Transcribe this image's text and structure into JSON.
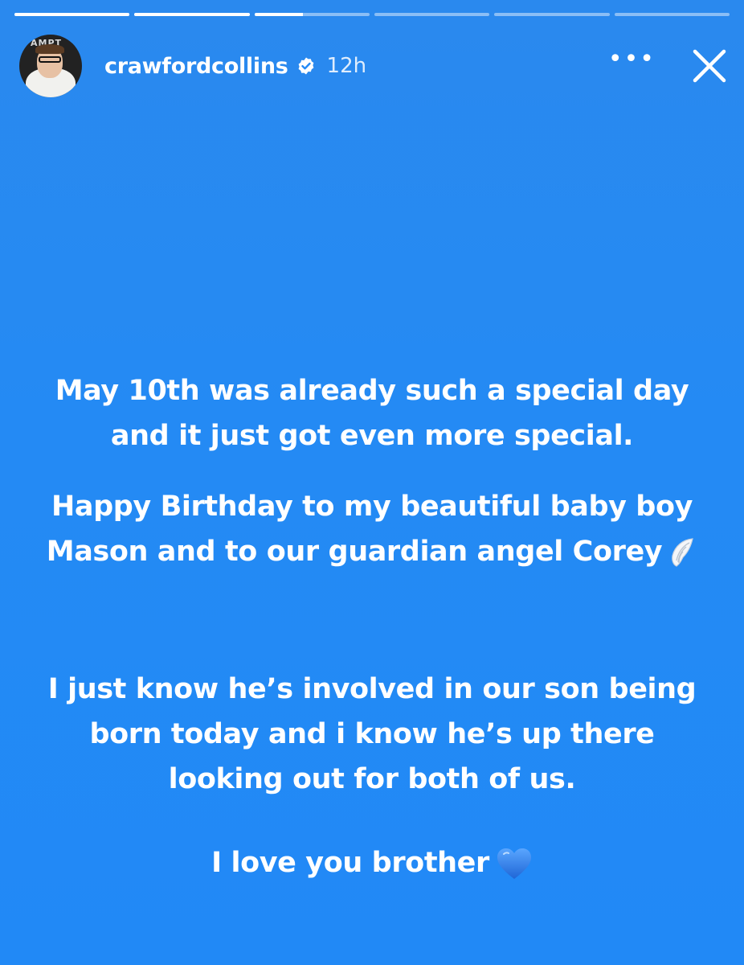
{
  "story": {
    "segments": [
      {
        "progress": 1.0
      },
      {
        "progress": 1.0
      },
      {
        "progress": 0.42
      },
      {
        "progress": 0.0
      },
      {
        "progress": 0.0
      },
      {
        "progress": 0.0
      }
    ]
  },
  "header": {
    "username": "crawfordcollins",
    "time": "12h",
    "more_label": "•••",
    "avatar_text": "AMPT"
  },
  "message": {
    "para1": "May 10th was already such a special day and it just got even more special.",
    "para2": "Happy Birthday to my beautiful baby boy Mason and to our guardian angel Corey",
    "para3": "I just know he’s involved in our son being born today and i know he’s up there looking out for both of us.",
    "para4": "I love you brother"
  },
  "colors": {
    "background": "#2189f6",
    "text": "#ffffff",
    "heart": "#2f7fe8"
  },
  "icons": {
    "wing": "angel-wing-icon",
    "heart": "blue-heart-icon",
    "verified": "verified-badge-icon",
    "close": "close-icon"
  }
}
